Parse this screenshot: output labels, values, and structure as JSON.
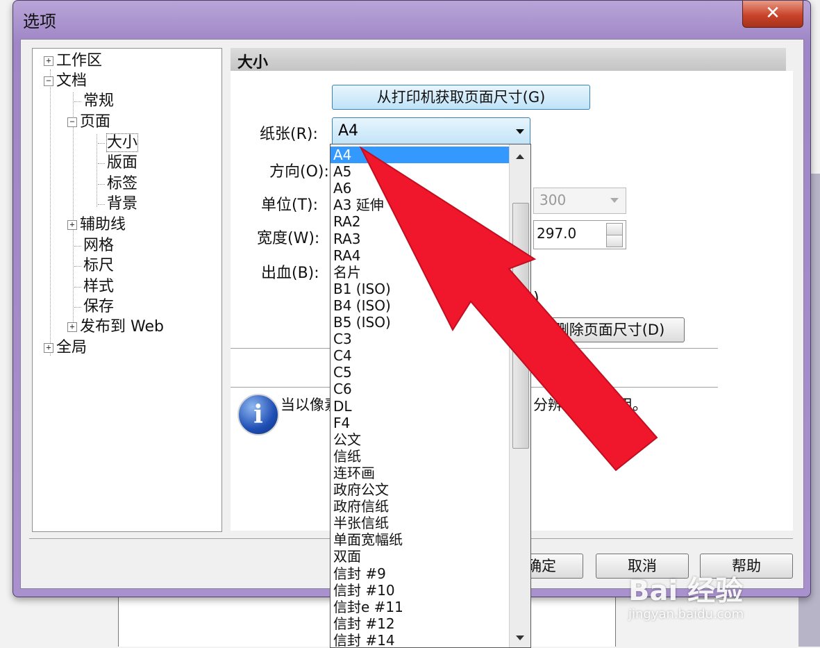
{
  "window": {
    "title": "选项",
    "close_label": "✕"
  },
  "tree": {
    "items": [
      {
        "label": "工作区",
        "expander": "+"
      },
      {
        "label": "文档",
        "expander": "−"
      },
      {
        "label": "常规"
      },
      {
        "label": "页面",
        "expander": "−"
      },
      {
        "label": "大小"
      },
      {
        "label": "版面"
      },
      {
        "label": "标签"
      },
      {
        "label": "背景"
      },
      {
        "label": "辅助线",
        "expander": "+"
      },
      {
        "label": "网格"
      },
      {
        "label": "标尺"
      },
      {
        "label": "样式"
      },
      {
        "label": "保存"
      },
      {
        "label": "发布到 Web",
        "expander": "+"
      },
      {
        "label": "全局",
        "expander": "+"
      }
    ]
  },
  "panel": {
    "heading": "大小",
    "get_from_printer_label": "从打印机获取页面尺寸(G)",
    "paper_label": "纸张(R):",
    "paper_value": "A4",
    "orientation_label": "方向(O):",
    "unit_label": "单位(T):",
    "resolution_value": "300",
    "width_label": "宽度(W):",
    "height_value": "297.0",
    "bleed_label": "出血(B):",
    "partial_paren": ")",
    "delete_page_size_label": "删除页面尺寸(D)",
    "info_text_start": "当以像素",
    "info_text_end": "分辨",
    "info_text_tail": "用。"
  },
  "paper_options": [
    "A4",
    "A5",
    "A6",
    "A3 延伸",
    "RA2",
    "RA3",
    "RA4",
    "名片",
    "B1 (ISO)",
    "B4 (ISO)",
    "B5 (ISO)",
    "C3",
    "C4",
    "C5",
    "C6",
    "DL",
    "F4",
    "公文",
    "信纸",
    "连环画",
    "政府公文",
    "政府信纸",
    "半张信纸",
    "单面宽幅纸",
    "双面",
    "信封 #9",
    "信封 #10",
    "信封e #11",
    "信封 #12",
    "信封 #14"
  ],
  "footer": {
    "ok_label": "确定",
    "cancel_label": "取消",
    "help_label": "帮助"
  },
  "watermark": {
    "brand": "Bai 经验",
    "url": "jingyan.baidu.com"
  },
  "colors": {
    "selection": "#3399ff",
    "arrow": "#f0162b",
    "title_bar": "#a891cc"
  }
}
